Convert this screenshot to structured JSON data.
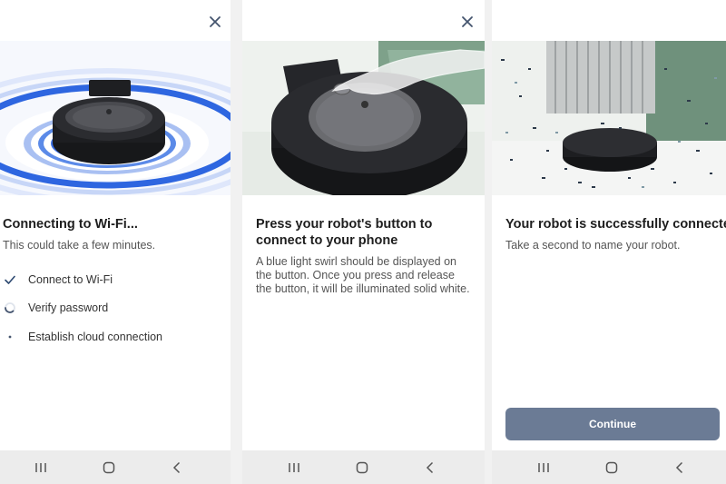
{
  "screens": [
    {
      "title": "Connecting to Wi-Fi...",
      "subtitle": "This could take a few minutes.",
      "steps": [
        {
          "label": "Connect to Wi-Fi",
          "state": "done",
          "icon": "checkmark-icon"
        },
        {
          "label": "Verify password",
          "state": "in-progress",
          "icon": "spinner-icon"
        },
        {
          "label": "Establish cloud connection",
          "state": "pending",
          "icon": "bullet-icon"
        }
      ]
    },
    {
      "title": "Press your robot's button to connect to your phone",
      "body": "A blue light swirl should be displayed on the button. Once you press and release the button, it will be illuminated solid white."
    },
    {
      "title": "Your robot is successfully connected!",
      "subtitle": "Take a second to name your robot.",
      "continue_label": "Continue"
    }
  ],
  "colors": {
    "accent_blue": "#2e66e0",
    "button": "#6b7b95",
    "check": "#2c4870",
    "navbar": "#ececec"
  },
  "icons": {
    "close": "close-icon",
    "nav_recent": "recent-apps-icon",
    "nav_home": "home-icon",
    "nav_back": "back-icon"
  }
}
